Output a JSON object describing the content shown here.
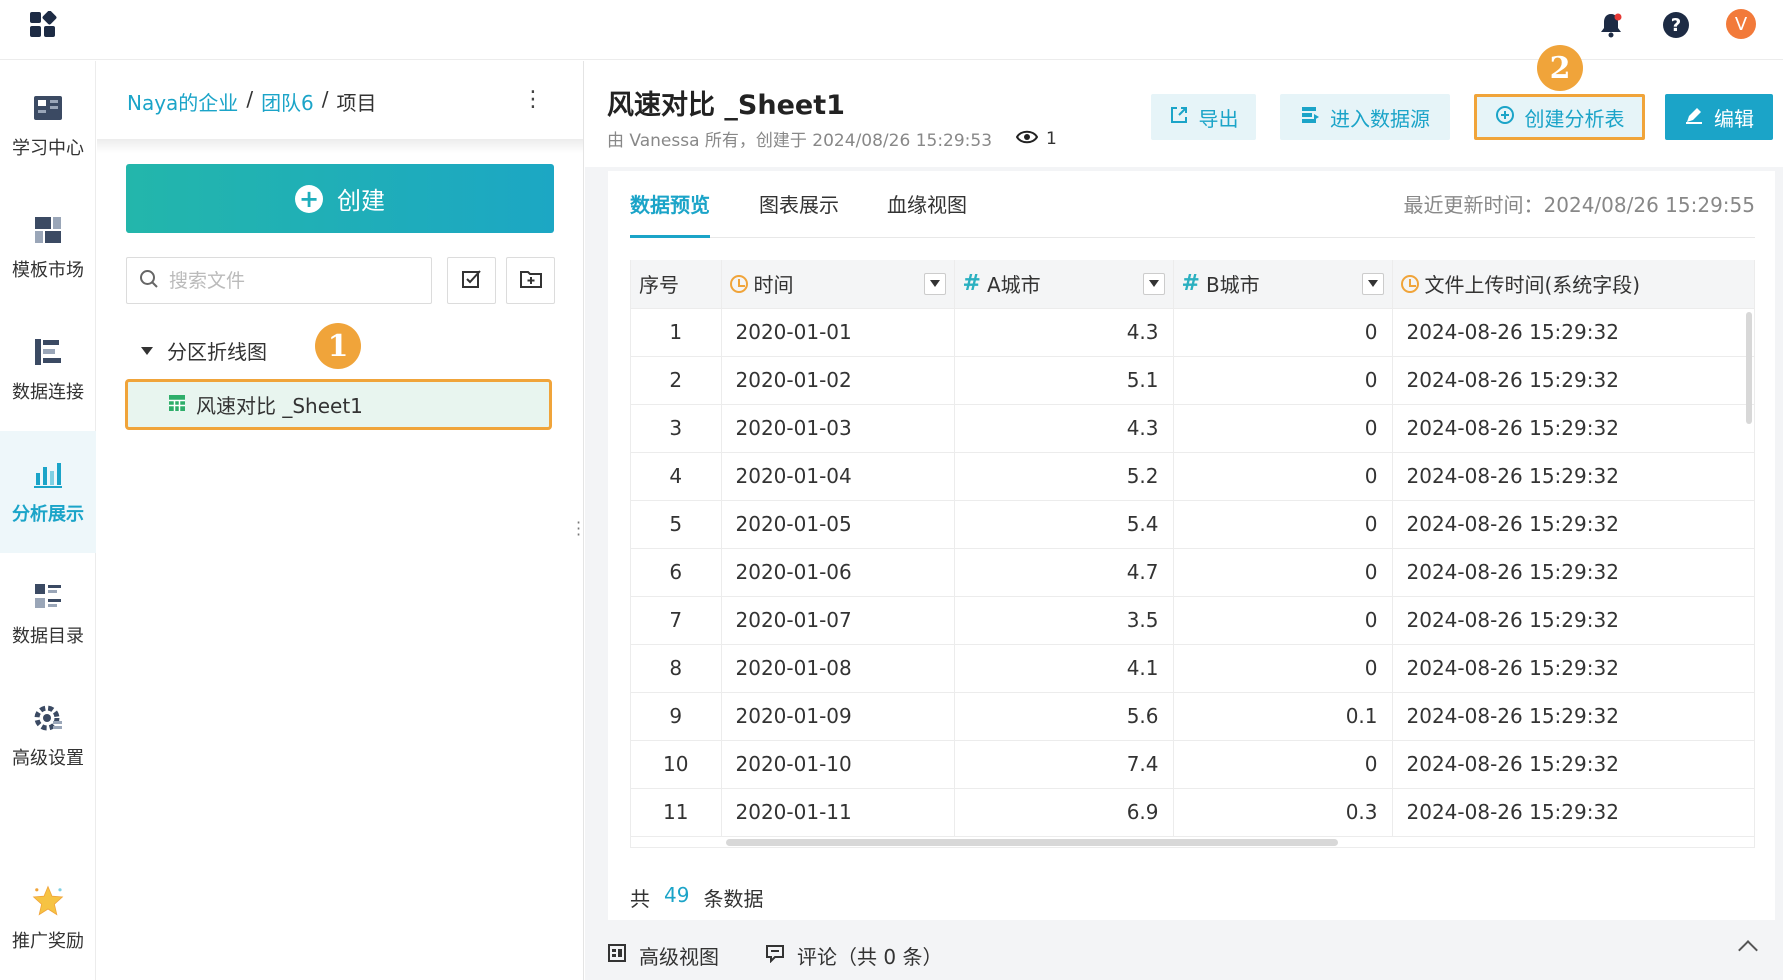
{
  "topbar": {
    "logo_icon": "app-grid-icon",
    "bell_icon": "bell-icon",
    "help_icon": "help-icon",
    "avatar_letter": "V",
    "avatar_color": "#f27a3a"
  },
  "nav": {
    "items": [
      {
        "label": "学习中心",
        "icon": "book-icon"
      },
      {
        "label": "模板市场",
        "icon": "template-icon"
      },
      {
        "label": "数据连接",
        "icon": "data-connect-icon"
      },
      {
        "label": "分析展示",
        "icon": "analysis-chart-icon",
        "active": true
      },
      {
        "label": "数据目录",
        "icon": "catalog-icon"
      },
      {
        "label": "高级设置",
        "icon": "gear-icon"
      },
      {
        "label": "推广奖励",
        "icon": "star-icon"
      }
    ]
  },
  "filepanel": {
    "breadcrumb": [
      "Naya的企业",
      "团队6",
      "项目"
    ],
    "breadcrumb_sep": "/",
    "create_label": "创建",
    "search_placeholder": "搜索文件",
    "folder_name": "分区折线图",
    "file_name": "风速对比 _Sheet1",
    "step1": "1"
  },
  "header": {
    "title": "风速对比 _Sheet1",
    "meta": "由 Vanessa 所有，创建于 2024/08/26 15:29:53",
    "views": "1",
    "export_label": "导出",
    "datasource_label": "进入数据源",
    "create_analysis_label": "创建分析表",
    "edit_label": "编辑",
    "step2": "2"
  },
  "tabs": {
    "items": [
      "数据预览",
      "图表展示",
      "血缘视图"
    ],
    "updated_label": "最近更新时间：",
    "updated_value": "2024/08/26 15:29:55"
  },
  "table": {
    "columns": [
      "序号",
      "时间",
      "A城市",
      "B城市",
      "文件上传时间(系统字段)"
    ],
    "rows": [
      [
        "1",
        "2020-01-01",
        "4.3",
        "0",
        "2024-08-26 15:29:32"
      ],
      [
        "2",
        "2020-01-02",
        "5.1",
        "0",
        "2024-08-26 15:29:32"
      ],
      [
        "3",
        "2020-01-03",
        "4.3",
        "0",
        "2024-08-26 15:29:32"
      ],
      [
        "4",
        "2020-01-04",
        "5.2",
        "0",
        "2024-08-26 15:29:32"
      ],
      [
        "5",
        "2020-01-05",
        "5.4",
        "0",
        "2024-08-26 15:29:32"
      ],
      [
        "6",
        "2020-01-06",
        "4.7",
        "0",
        "2024-08-26 15:29:32"
      ],
      [
        "7",
        "2020-01-07",
        "3.5",
        "0",
        "2024-08-26 15:29:32"
      ],
      [
        "8",
        "2020-01-08",
        "4.1",
        "0",
        "2024-08-26 15:29:32"
      ],
      [
        "9",
        "2020-01-09",
        "5.6",
        "0.1",
        "2024-08-26 15:29:32"
      ],
      [
        "10",
        "2020-01-10",
        "7.4",
        "0",
        "2024-08-26 15:29:32"
      ],
      [
        "11",
        "2020-01-11",
        "6.9",
        "0.3",
        "2024-08-26 15:29:32"
      ]
    ],
    "total_prefix": "共",
    "total_count": "49",
    "total_suffix": "条数据"
  },
  "bottom": {
    "advanced_view_label": "高级视图",
    "comments_label": "评论（共 0 条）"
  },
  "colors": {
    "accent": "#1ba4c8",
    "highlight": "#f0a43a"
  }
}
